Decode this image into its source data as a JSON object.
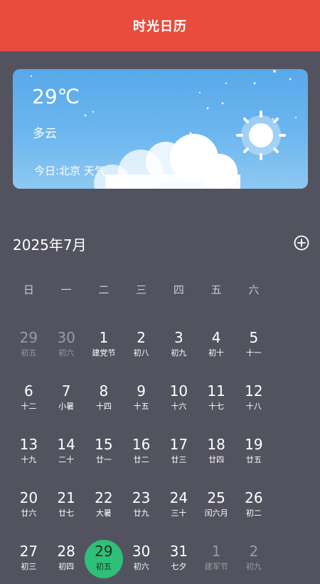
{
  "header": {
    "title": "时光日历"
  },
  "weather": {
    "temperature": "29℃",
    "condition": "多云",
    "location_text": "今日:北京 天气"
  },
  "calendar": {
    "month_label": "2025年7月",
    "weekdays": [
      "日",
      "一",
      "二",
      "三",
      "四",
      "五",
      "六"
    ],
    "weeks": [
      [
        {
          "day": "29",
          "lunar": "初五",
          "other": true
        },
        {
          "day": "30",
          "lunar": "初六",
          "other": true
        },
        {
          "day": "1",
          "lunar": "建党节"
        },
        {
          "day": "2",
          "lunar": "初八"
        },
        {
          "day": "3",
          "lunar": "初九"
        },
        {
          "day": "4",
          "lunar": "初十"
        },
        {
          "day": "5",
          "lunar": "十一"
        }
      ],
      [
        {
          "day": "6",
          "lunar": "十二"
        },
        {
          "day": "7",
          "lunar": "小暑"
        },
        {
          "day": "8",
          "lunar": "十四"
        },
        {
          "day": "9",
          "lunar": "十五"
        },
        {
          "day": "10",
          "lunar": "十六"
        },
        {
          "day": "11",
          "lunar": "十七"
        },
        {
          "day": "12",
          "lunar": "十八"
        }
      ],
      [
        {
          "day": "13",
          "lunar": "十九"
        },
        {
          "day": "14",
          "lunar": "二十"
        },
        {
          "day": "15",
          "lunar": "廿一"
        },
        {
          "day": "16",
          "lunar": "廿二"
        },
        {
          "day": "17",
          "lunar": "廿三"
        },
        {
          "day": "18",
          "lunar": "廿四"
        },
        {
          "day": "19",
          "lunar": "廿五"
        }
      ],
      [
        {
          "day": "20",
          "lunar": "廿六"
        },
        {
          "day": "21",
          "lunar": "廿七"
        },
        {
          "day": "22",
          "lunar": "大暑"
        },
        {
          "day": "23",
          "lunar": "廿九"
        },
        {
          "day": "24",
          "lunar": "三十"
        },
        {
          "day": "25",
          "lunar": "闰六月"
        },
        {
          "day": "26",
          "lunar": "初二"
        }
      ],
      [
        {
          "day": "27",
          "lunar": "初三"
        },
        {
          "day": "28",
          "lunar": "初四"
        },
        {
          "day": "29",
          "lunar": "初五",
          "today": true
        },
        {
          "day": "30",
          "lunar": "初六"
        },
        {
          "day": "31",
          "lunar": "七夕"
        },
        {
          "day": "1",
          "lunar": "建军节",
          "other": true
        },
        {
          "day": "2",
          "lunar": "初九",
          "other": true
        }
      ]
    ]
  },
  "icons": {
    "add": "plus-circle-icon",
    "weather": "sun-icon"
  },
  "colors": {
    "header": "#e84c3d",
    "background": "#53535f",
    "today_highlight": "#2fbf78",
    "weather_card": "#6db7ef"
  }
}
